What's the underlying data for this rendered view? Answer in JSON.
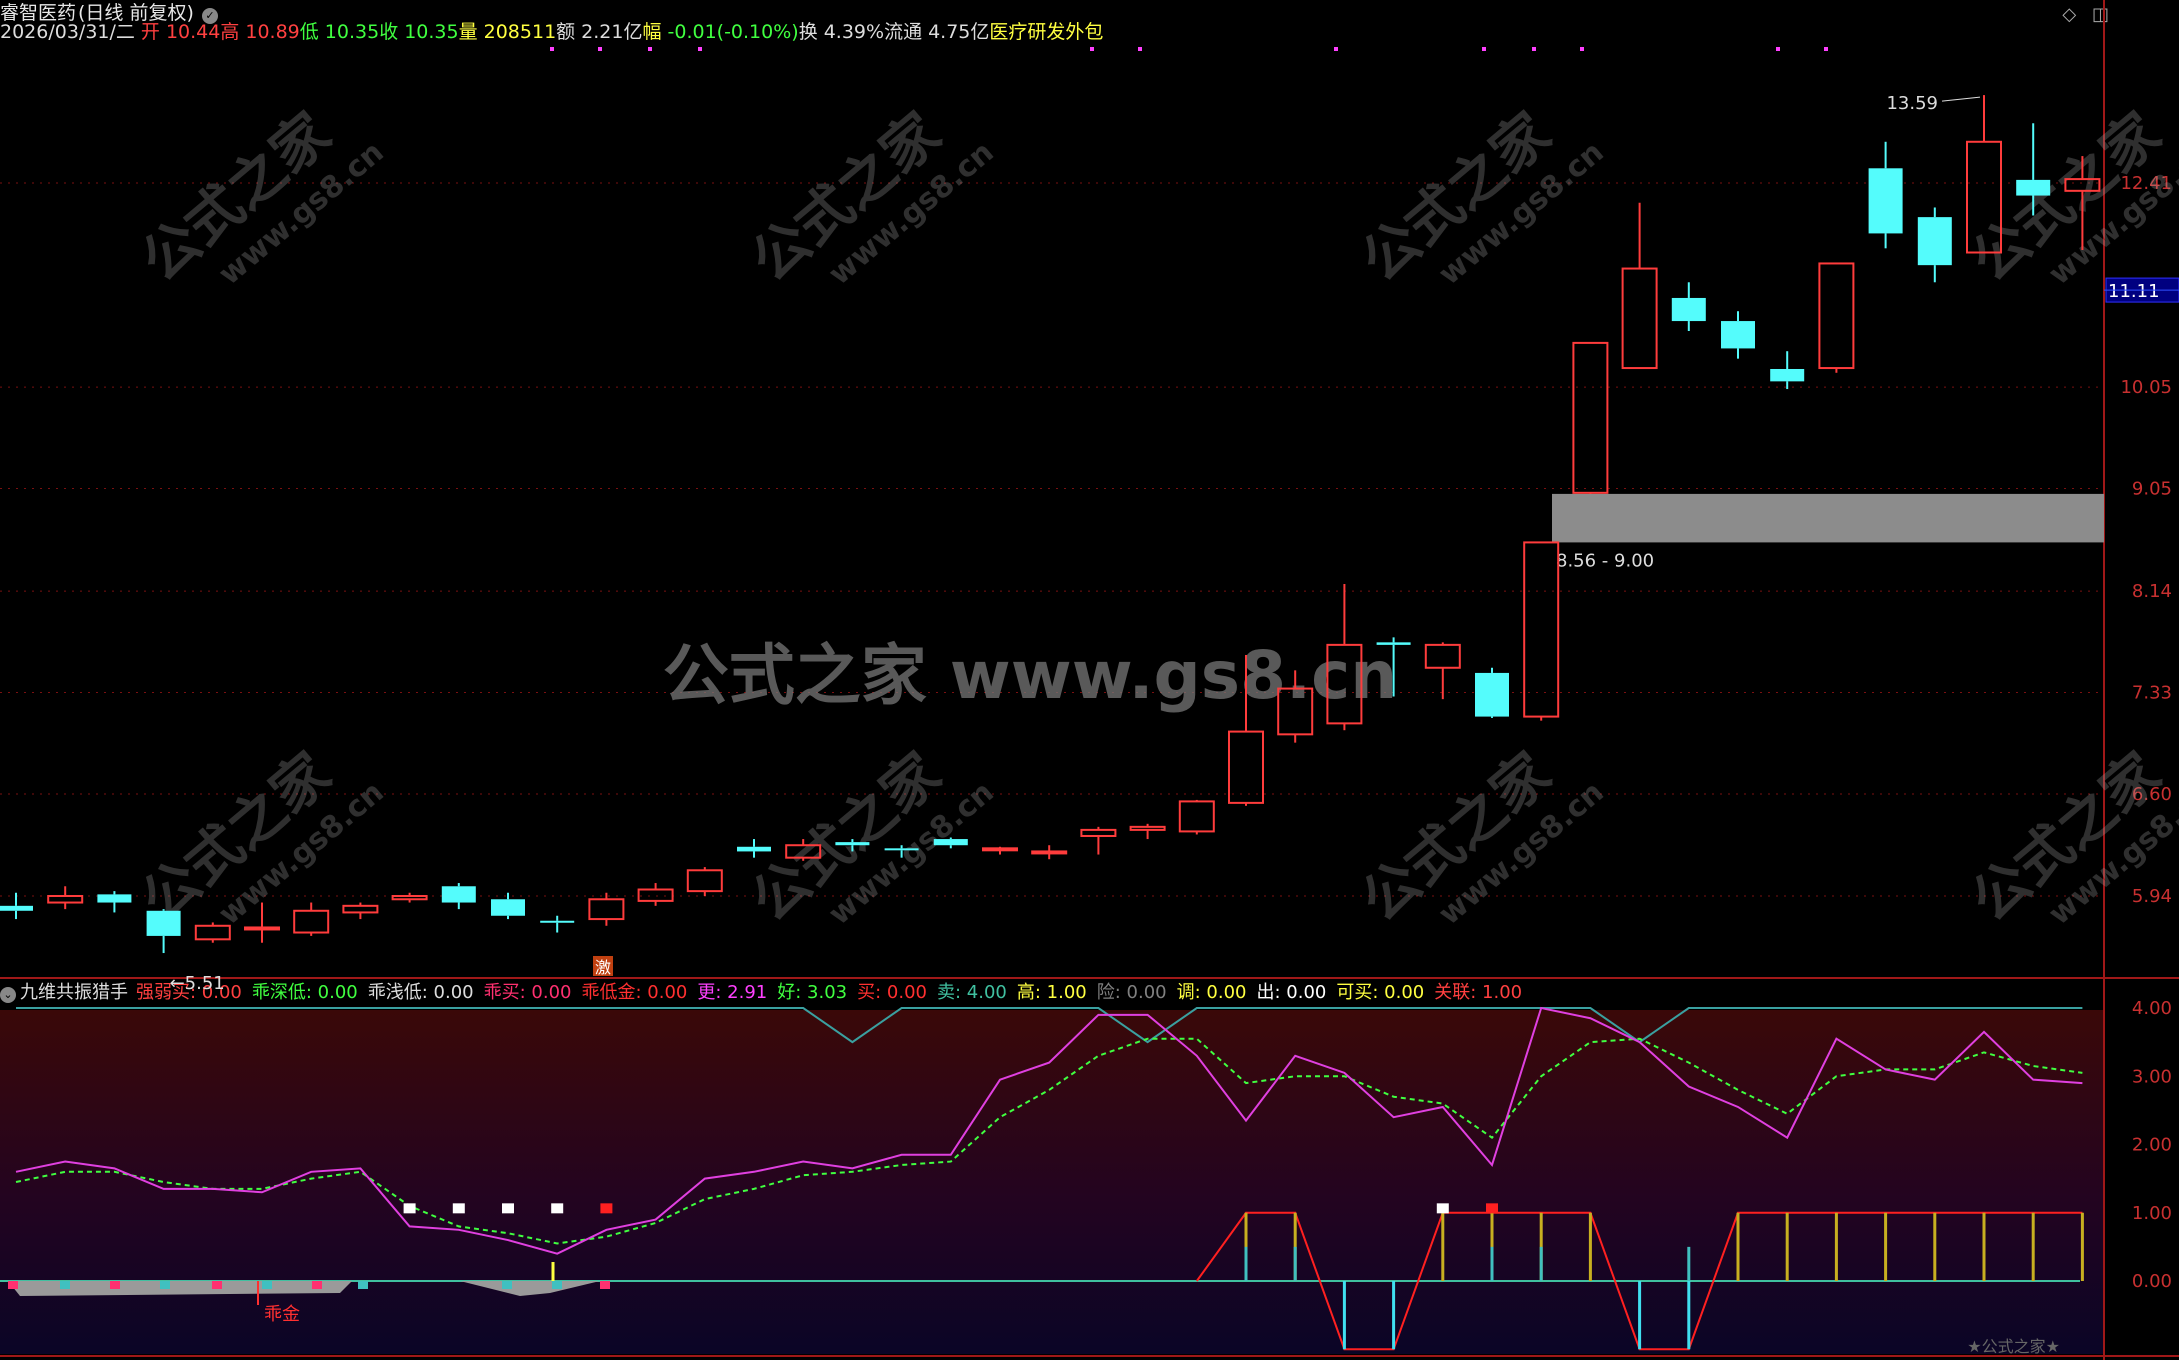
{
  "header": {
    "stock_name": "睿智医药",
    "period": "(日线 前复权)",
    "date": "2026/03/31/二",
    "open_label": "开",
    "open": "10.44",
    "high_label": "高",
    "high": "10.89",
    "low_label": "低",
    "low": "10.35",
    "close_label": "收",
    "close": "10.35",
    "volume_label": "量",
    "volume": "208511",
    "amount_label": "额",
    "amount": "2.21亿",
    "change_label": "幅",
    "change": "-0.01(-0.10%)",
    "turnover_label": "换",
    "turnover": "4.39%",
    "float_label": "流通",
    "float_cap": "4.75亿",
    "sector": "医疗研发外包",
    "chevron_icon": "circle-chevron-icon"
  },
  "main_chart": {
    "y_ticks": [
      "12.41",
      "10.05",
      "9.05",
      "8.14",
      "7.33",
      "6.60",
      "5.94"
    ],
    "current_price": "11.11",
    "high_marker": "13.59",
    "low_marker": "5.51",
    "zone_label": "8.56 - 9.00",
    "signal_char": "激",
    "watermark_center": "公式之家 www.gs8.cn",
    "watermark_tile": "公式之家",
    "watermark_tile_url": "www.gs8.cn"
  },
  "indicator": {
    "name": "九维共振猎手",
    "params": [
      {
        "label": "强弱买:",
        "value": "0.00",
        "color": "#ff4040"
      },
      {
        "label": "乖深低:",
        "value": "0.00",
        "color": "#40ff40"
      },
      {
        "label": "乖浅低:",
        "value": "0.00",
        "color": "#dddddd"
      },
      {
        "label": "乖买:",
        "value": "0.00",
        "color": "#ff3070"
      },
      {
        "label": "乖低金:",
        "value": "0.00",
        "color": "#ff3030"
      },
      {
        "label": "更:",
        "value": "2.91",
        "color": "#ff40ff"
      },
      {
        "label": "好:",
        "value": "3.03",
        "color": "#40ff40"
      },
      {
        "label": "买:",
        "value": "0.00",
        "color": "#ff3030"
      },
      {
        "label": "卖:",
        "value": "4.00",
        "color": "#40c0a0"
      },
      {
        "label": "高:",
        "value": "1.00",
        "color": "#ffff40"
      },
      {
        "label": "险:",
        "value": "0.00",
        "color": "#808080"
      },
      {
        "label": "调:",
        "value": "0.00",
        "color": "#ffff40"
      },
      {
        "label": "出:",
        "value": "0.00",
        "color": "#ffffff"
      },
      {
        "label": "可买:",
        "value": "0.00",
        "color": "#ffff40"
      },
      {
        "label": "关联:",
        "value": "1.00",
        "color": "#ff4040"
      }
    ],
    "y_ticks": [
      "4.00",
      "3.00",
      "2.00",
      "1.00",
      "0.00"
    ],
    "signal_text": "乖金",
    "footer_watermark": "★公式之家★"
  },
  "chart_data": {
    "type": "candlestick",
    "candles": [
      [
        5.88,
        5.85,
        5.96,
        5.8
      ],
      [
        5.9,
        5.94,
        6.0,
        5.86
      ],
      [
        5.95,
        5.9,
        5.97,
        5.84
      ],
      [
        5.85,
        5.7,
        5.86,
        5.6
      ],
      [
        5.68,
        5.76,
        5.78,
        5.66
      ],
      [
        5.74,
        5.75,
        5.9,
        5.66
      ],
      [
        5.72,
        5.85,
        5.9,
        5.7
      ],
      [
        5.84,
        5.88,
        5.9,
        5.8
      ],
      [
        5.92,
        5.94,
        5.96,
        5.9
      ],
      [
        6.0,
        5.9,
        6.02,
        5.86
      ],
      [
        5.92,
        5.82,
        5.96,
        5.8
      ],
      [
        5.79,
        5.78,
        5.82,
        5.72
      ],
      [
        5.8,
        5.92,
        5.96,
        5.76
      ],
      [
        5.91,
        5.98,
        6.02,
        5.88
      ],
      [
        5.97,
        6.1,
        6.12,
        5.94
      ],
      [
        6.25,
        6.22,
        6.3,
        6.18
      ],
      [
        6.18,
        6.26,
        6.3,
        6.16
      ],
      [
        6.28,
        6.26,
        6.3,
        6.22
      ],
      [
        6.24,
        6.23,
        6.26,
        6.18
      ],
      [
        6.3,
        6.26,
        6.31,
        6.24
      ],
      [
        6.24,
        6.24,
        6.25,
        6.2
      ],
      [
        6.22,
        6.22,
        6.26,
        6.17
      ],
      [
        6.32,
        6.36,
        6.38,
        6.2
      ],
      [
        6.36,
        6.38,
        6.4,
        6.3
      ],
      [
        6.35,
        6.55,
        6.56,
        6.33
      ],
      [
        6.54,
        7.04,
        7.62,
        6.52
      ],
      [
        7.02,
        7.36,
        7.5,
        6.96
      ],
      [
        7.1,
        7.7,
        8.2,
        7.05
      ],
      [
        7.72,
        7.7,
        7.76,
        7.3
      ],
      [
        7.52,
        7.7,
        7.72,
        7.28
      ],
      [
        7.48,
        7.15,
        7.52,
        7.14
      ],
      [
        7.15,
        8.56,
        8.56,
        7.12
      ],
      [
        9.01,
        10.52,
        10.52,
        9.0
      ],
      [
        10.25,
        11.36,
        12.16,
        10.25
      ],
      [
        11.02,
        10.76,
        11.2,
        10.65
      ],
      [
        10.76,
        10.46,
        10.87,
        10.35
      ],
      [
        10.24,
        10.11,
        10.43,
        10.03
      ],
      [
        10.25,
        11.42,
        11.42,
        10.2
      ],
      [
        12.6,
        11.78,
        12.95,
        11.6
      ],
      [
        11.98,
        11.4,
        12.1,
        11.2
      ],
      [
        11.55,
        12.95,
        13.59,
        11.55
      ],
      [
        12.45,
        12.25,
        13.2,
        12.0
      ],
      [
        12.31,
        12.46,
        12.76,
        11.58
      ]
    ],
    "y_ticks": [
      12.41,
      10.05,
      9.05,
      8.14,
      7.33,
      6.6,
      5.94
    ],
    "indicator_lines": {
      "magenta": [
        1.6,
        1.75,
        1.65,
        1.35,
        1.35,
        1.3,
        1.6,
        1.65,
        0.8,
        0.75,
        0.6,
        0.4,
        0.75,
        0.9,
        1.5,
        1.6,
        1.75,
        1.65,
        1.85,
        1.85,
        2.95,
        3.2,
        3.9,
        3.9,
        3.3,
        2.35,
        3.3,
        3.05,
        2.4,
        2.55,
        1.7,
        4.0,
        3.85,
        3.5,
        2.85,
        2.55,
        2.1,
        3.55,
        3.1,
        2.95,
        3.65,
        2.95,
        2.9
      ],
      "green_dashed": [
        1.45,
        1.6,
        1.6,
        1.45,
        1.35,
        1.35,
        1.5,
        1.6,
        1.1,
        0.8,
        0.7,
        0.55,
        0.65,
        0.85,
        1.2,
        1.35,
        1.55,
        1.6,
        1.7,
        1.75,
        2.4,
        2.8,
        3.3,
        3.55,
        3.55,
        2.9,
        3.0,
        3.0,
        2.7,
        2.6,
        2.1,
        3.0,
        3.5,
        3.55,
        3.2,
        2.8,
        2.45,
        3.0,
        3.1,
        3.1,
        3.35,
        3.15,
        3.05
      ],
      "teal_top": [
        4,
        4,
        4,
        4,
        4,
        4,
        4,
        4,
        4,
        4,
        4,
        4,
        4,
        4,
        4,
        4,
        4,
        3.5,
        4,
        4,
        4,
        4,
        4,
        3.5,
        4,
        4,
        4,
        4,
        4,
        4,
        4,
        4,
        4,
        3.5,
        4,
        4,
        4,
        4,
        4,
        4,
        4,
        4,
        4
      ]
    }
  }
}
